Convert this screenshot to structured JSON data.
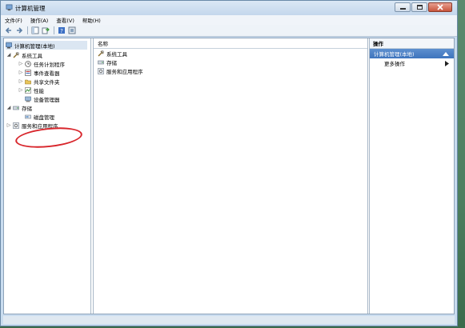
{
  "window": {
    "title": "计算机管理",
    "buttons": [
      "minimize",
      "maximize",
      "close"
    ]
  },
  "menubar": {
    "items": [
      "文件(F)",
      "操作(A)",
      "查看(V)",
      "帮助(H)"
    ]
  },
  "toolbar": {
    "icons": [
      "back-arrow-icon",
      "forward-arrow-icon",
      "console-tree-icon",
      "export-list-icon",
      "help-icon",
      "properties-icon"
    ]
  },
  "tree": {
    "root": "计算机管理(本地)",
    "system_tools": "系统工具",
    "task_scheduler": "任务计划程序",
    "event_viewer": "事件查看器",
    "shared_folders": "共享文件夹",
    "performance": "性能",
    "device_manager": "设备管理器",
    "storage": "存储",
    "disk_management": "磁盘管理",
    "services_apps": "服务和应用程序"
  },
  "middle": {
    "column_header": "名称",
    "items": [
      "系统工具",
      "存储",
      "服务和应用程序"
    ]
  },
  "actions": {
    "header": "操作",
    "section": "计算机管理(本地)",
    "more_actions": "更多操作"
  },
  "annotation": {
    "highlight_color": "#d8262c"
  }
}
